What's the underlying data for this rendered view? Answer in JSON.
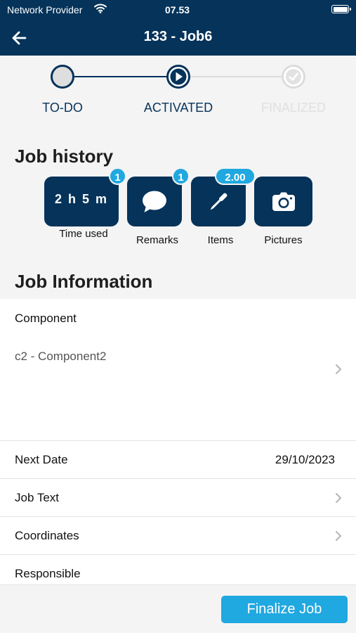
{
  "status_bar": {
    "carrier": "Network Provider",
    "time": "07.53"
  },
  "nav": {
    "title": "133 - Job6"
  },
  "stepper": {
    "steps": [
      {
        "label": "TO-DO",
        "state": "done"
      },
      {
        "label": "ACTIVATED",
        "state": "current"
      },
      {
        "label": "FINALIZED",
        "state": "pending"
      }
    ]
  },
  "job_history": {
    "title": "Job history",
    "tiles": [
      {
        "display": "2 h 5 m",
        "label": "Time used",
        "badge": "1",
        "icon": ""
      },
      {
        "display": "",
        "label": "Remarks",
        "badge": "1",
        "icon": "speech-bubble-icon"
      },
      {
        "display": "",
        "label": "Items",
        "badge": "2.00",
        "icon": "screwdriver-icon"
      },
      {
        "display": "",
        "label": "Pictures",
        "badge": "",
        "icon": "camera-icon"
      }
    ]
  },
  "job_information": {
    "title": "Job Information",
    "component": {
      "label": "Component",
      "value": "c2 - Component2"
    },
    "next_date": {
      "label": "Next Date",
      "value": "29/10/2023"
    },
    "job_text": {
      "label": "Job Text"
    },
    "coordinates": {
      "label": "Coordinates"
    },
    "responsible": {
      "label": "Responsible"
    }
  },
  "footer": {
    "finalize_label": "Finalize Job"
  },
  "colors": {
    "navy": "#05335a",
    "accent": "#20a8e0",
    "background": "#f4f4f4",
    "inactive": "#dcdcdc"
  }
}
